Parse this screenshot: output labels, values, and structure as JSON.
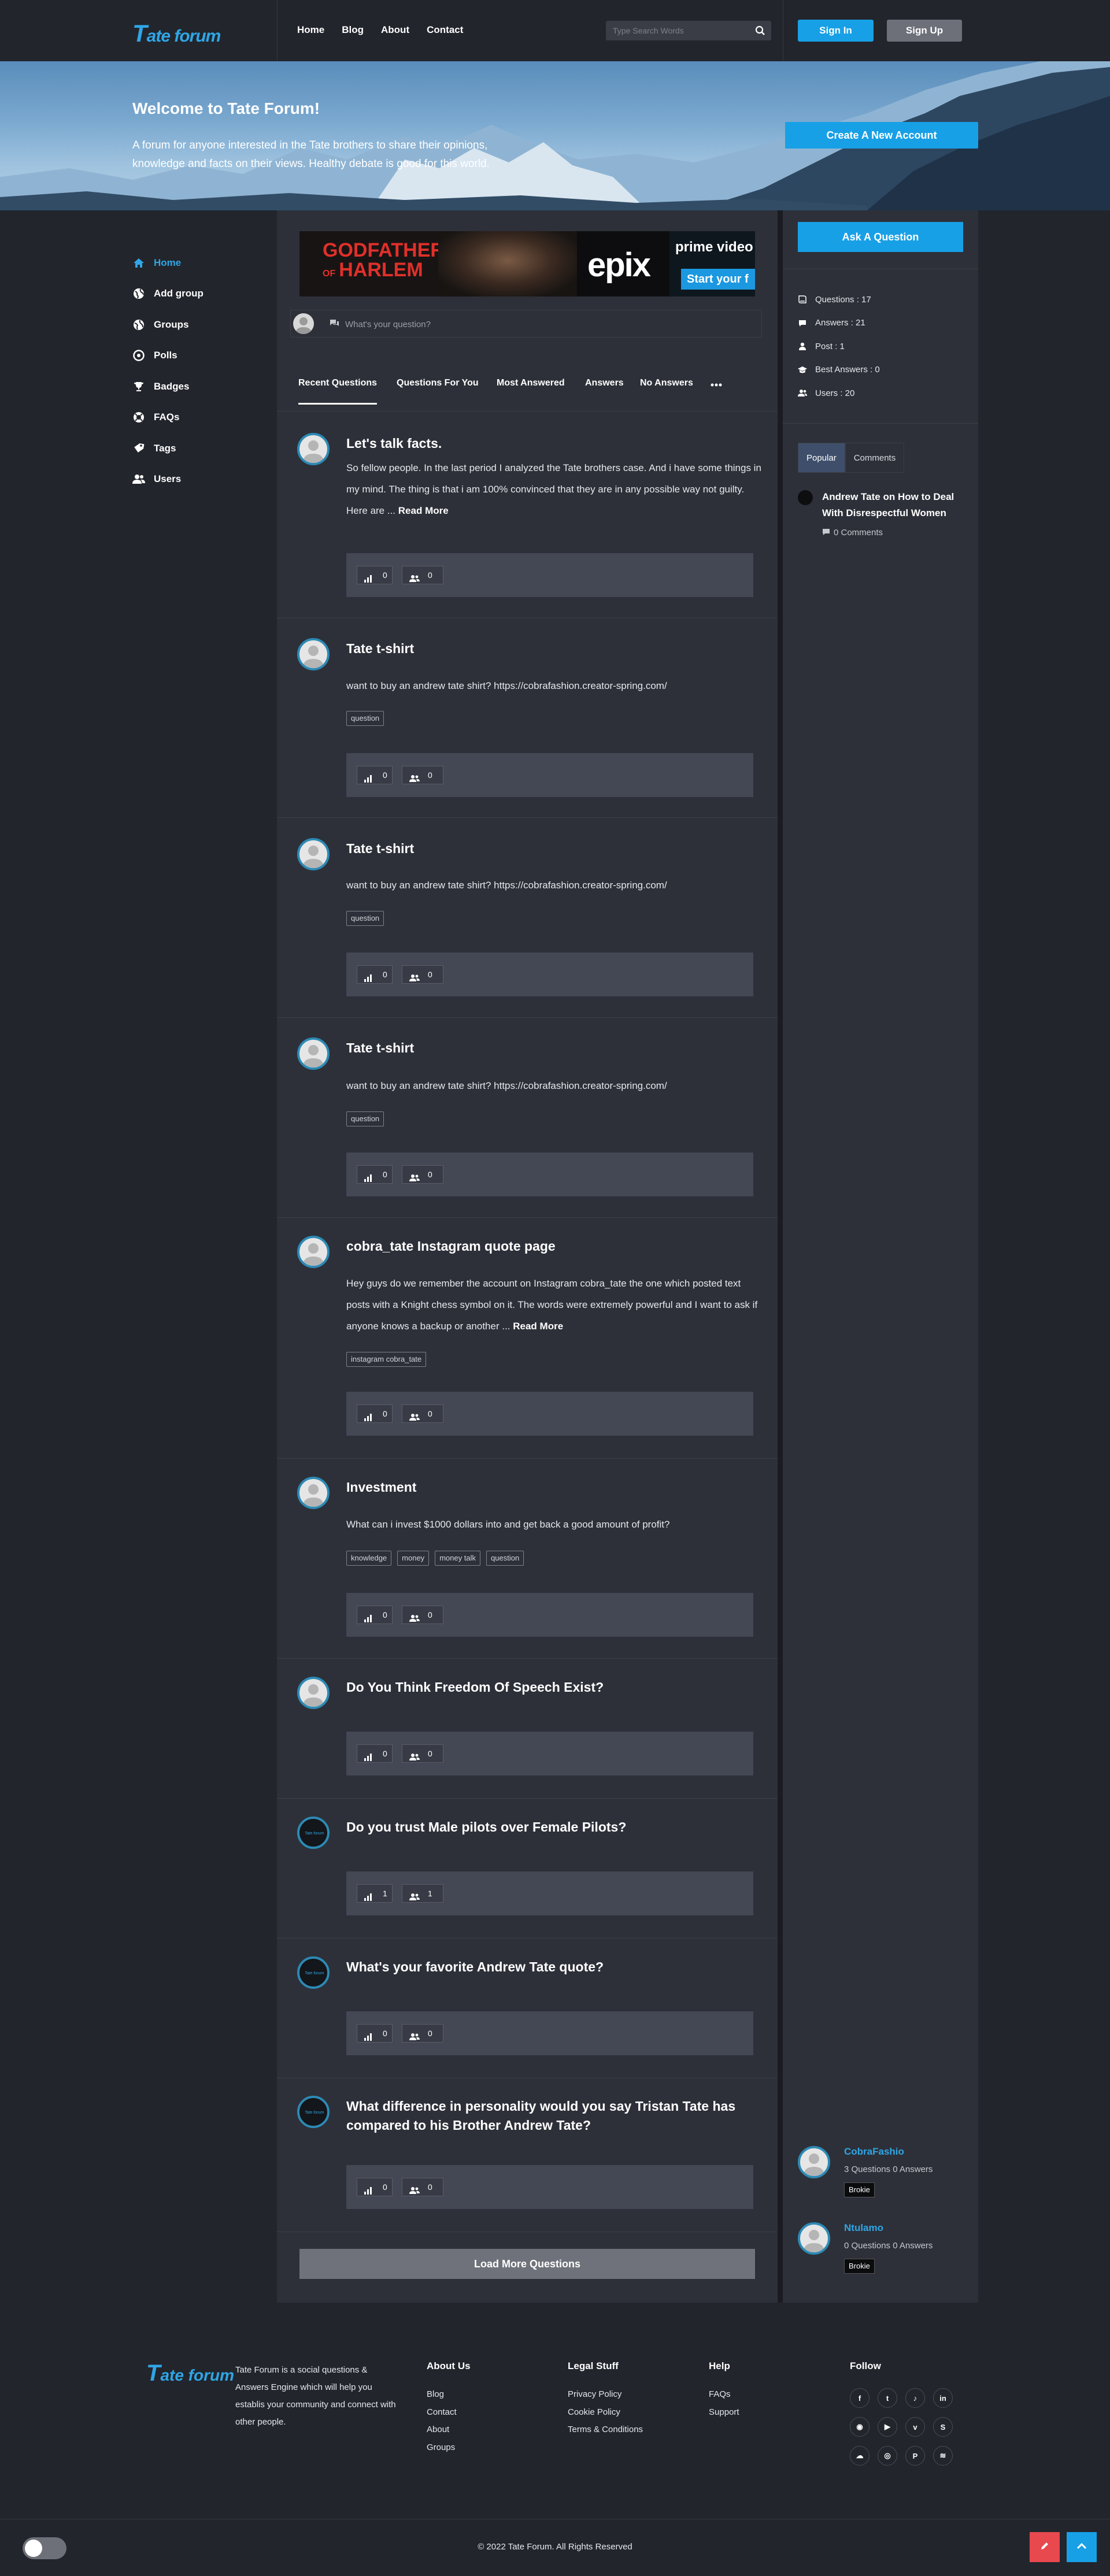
{
  "brand": {
    "logo_text": "Tate forum",
    "accent_color": "#18a0e6"
  },
  "header": {
    "nav": [
      "Home",
      "Blog",
      "About",
      "Contact"
    ],
    "search_placeholder": "Type Search Words",
    "signin_label": "Sign In",
    "signup_label": "Sign Up"
  },
  "hero": {
    "title": "Welcome to Tate Forum!",
    "description": "A forum for anyone interested in the Tate brothers to share their opinions, knowledge and facts on their views. Healthy debate is good for this world.",
    "cta_label": "Create A New Account"
  },
  "sidebar": {
    "items": [
      {
        "label": "Home",
        "icon": "home-icon"
      },
      {
        "label": "Add group",
        "icon": "globe-plus-icon"
      },
      {
        "label": "Groups",
        "icon": "globe-icon"
      },
      {
        "label": "Polls",
        "icon": "poll-icon"
      },
      {
        "label": "Badges",
        "icon": "trophy-icon"
      },
      {
        "label": "FAQs",
        "icon": "life-ring-icon"
      },
      {
        "label": "Tags",
        "icon": "tag-icon"
      },
      {
        "label": "Users",
        "icon": "users-icon"
      }
    ]
  },
  "ad": {
    "line1": "GODFATHER",
    "line2": "OF",
    "line3": "HARLEM",
    "brand": "epix",
    "pv_title": "prime video",
    "pv_button": "Start your f"
  },
  "ask": {
    "placeholder": "What's your question?"
  },
  "tabs": [
    "Recent Questions",
    "Questions For You",
    "Most Answered",
    "Answers",
    "No Answers"
  ],
  "questions": [
    {
      "title": "Let's talk facts.",
      "text": "So fellow people. In the last period I analyzed the Tate brothers case. And i have some things in my mind. The thing is that i am 100% convinced that they are in any possible way not guilty. Here are ...",
      "read_more": "Read More",
      "tags": [],
      "stat1": "0",
      "stat2": "0"
    },
    {
      "title": "Tate t-shirt",
      "text": "want to buy an andrew tate shirt? https://cobrafashion.creator-spring.com/",
      "tags": [
        "question"
      ],
      "stat1": "0",
      "stat2": "0"
    },
    {
      "title": "Tate t-shirt",
      "text": "want to buy an andrew tate shirt? https://cobrafashion.creator-spring.com/",
      "tags": [
        "question"
      ],
      "stat1": "0",
      "stat2": "0"
    },
    {
      "title": "Tate t-shirt",
      "text": "want to buy an andrew tate shirt? https://cobrafashion.creator-spring.com/",
      "tags": [
        "question"
      ],
      "stat1": "0",
      "stat2": "0"
    },
    {
      "title": "cobra_tate Instagram quote page",
      "text": "Hey guys do we remember the account on Instagram cobra_tate the one which posted text posts with a Knight chess symbol on it. The words were extremely powerful and I want to ask if anyone knows a backup or another ...",
      "read_more": "Read More",
      "tags": [
        "instagram cobra_tate"
      ],
      "stat1": "0",
      "stat2": "0"
    },
    {
      "title": "Investment",
      "text": "What can i invest $1000 dollars into and get back a good amount of profit?",
      "tags": [
        "knowledge",
        "money",
        "money talk",
        "question"
      ],
      "stat1": "0",
      "stat2": "0"
    },
    {
      "title": "Do You Think Freedom Of Speech Exist?",
      "text": "",
      "tags": [],
      "stat1": "0",
      "stat2": "0"
    },
    {
      "title": "Do you trust Male pilots over Female Pilots?",
      "text": "",
      "tags": [],
      "stat1": "1",
      "stat2": "1"
    },
    {
      "title": "What's your favorite Andrew Tate quote?",
      "text": "",
      "tags": [],
      "stat1": "0",
      "stat2": "0"
    },
    {
      "title": "What difference in personality would you say Tristan Tate has compared to his Brother Andrew Tate?",
      "text": "",
      "tags": [],
      "stat1": "0",
      "stat2": "0"
    }
  ],
  "load_more": "Load More Questions",
  "right": {
    "ask_label": "Ask A Question",
    "stats": [
      {
        "label": "Questions : 17",
        "icon": "book-icon"
      },
      {
        "label": "Answers : 21",
        "icon": "comment-icon"
      },
      {
        "label": "Post : 1",
        "icon": "user-icon"
      },
      {
        "label": "Best Answers : 0",
        "icon": "graduation-icon"
      },
      {
        "label": "Users : 20",
        "icon": "users-icon"
      }
    ],
    "tabs": [
      "Popular",
      "Comments"
    ],
    "popular": {
      "title": "Andrew Tate on How to Deal With Disrespectful Women",
      "comments": "0 Comments"
    },
    "users": [
      {
        "name": "CobraFashio",
        "stats": "3 Questions   0 Answers",
        "badge": "Brokie"
      },
      {
        "name": "Ntulamo",
        "stats": "0 Questions   0 Answers",
        "badge": "Brokie"
      }
    ]
  },
  "footer": {
    "about": "Tate Forum is a social questions & Answers Engine which will help you establis your community and connect with other people.",
    "cols": [
      {
        "title": "About Us",
        "links": [
          "Blog",
          "Contact",
          "About",
          "Groups"
        ]
      },
      {
        "title": "Legal Stuff",
        "links": [
          "Privacy Policy",
          "Cookie Policy",
          "Terms & Conditions"
        ]
      },
      {
        "title": "Help",
        "links": [
          "FAQs",
          "Support"
        ]
      }
    ],
    "follow_title": "Follow",
    "social": [
      "f",
      "t",
      "♪",
      "in",
      "◉",
      "▶",
      "v",
      "S",
      "☁",
      "◎",
      "P",
      "≋"
    ],
    "copyright": "© 2022 Tate Forum. All Rights Reserved"
  }
}
